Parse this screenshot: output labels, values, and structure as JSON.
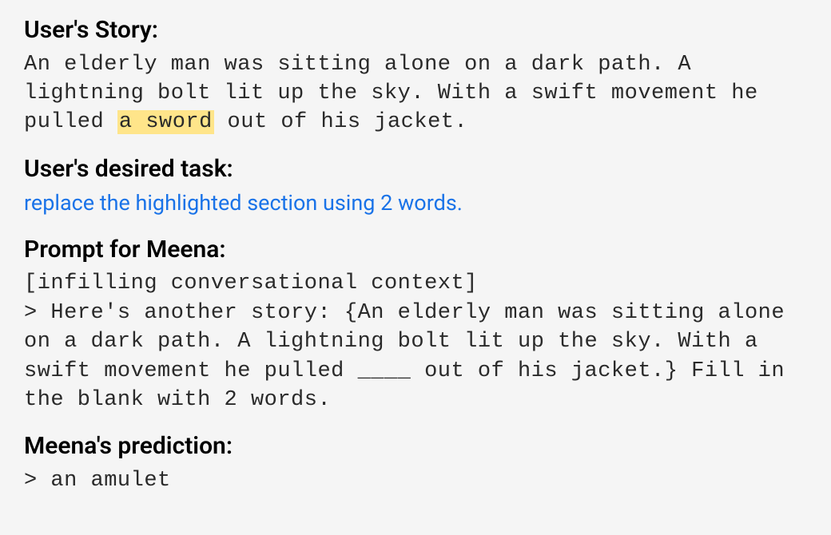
{
  "sections": {
    "story": {
      "heading": "User's Story:",
      "text_before": "An elderly man was sitting alone on a dark path. A lightning bolt lit up the sky. With a swift movement he pulled ",
      "highlighted": "a sword",
      "text_after": " out of his jacket."
    },
    "task": {
      "heading": "User's desired task:",
      "text": "replace the highlighted section using 2 words."
    },
    "prompt": {
      "heading": "Prompt for Meena:",
      "line1": "[infilling conversational context]",
      "line2": "> Here's another story: {An elderly man was sitting alone on a dark path. A lightning bolt lit up the sky. With a swift movement he pulled ____ out of his jacket.} Fill in the blank with 2 words."
    },
    "prediction": {
      "heading": "Meena's prediction:",
      "text": "> an amulet"
    }
  }
}
